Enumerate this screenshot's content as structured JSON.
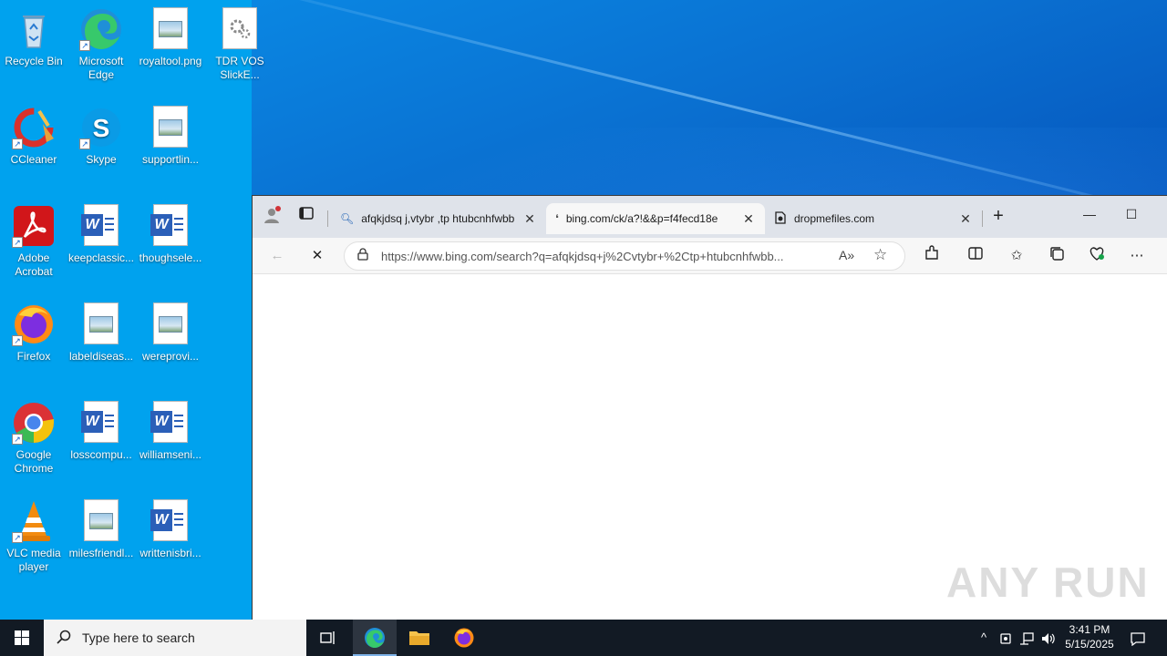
{
  "desktop": {
    "icons": [
      {
        "label": "Recycle Bin",
        "type": "recycle"
      },
      {
        "label": "Microsoft Edge",
        "type": "edge"
      },
      {
        "label": "royaltool.png",
        "type": "image"
      },
      {
        "label": "TDR VOS SlickE...",
        "type": "settings-file"
      },
      {
        "label": "CCleaner",
        "type": "ccleaner"
      },
      {
        "label": "Skype",
        "type": "skype"
      },
      {
        "label": "supportlin...",
        "type": "image"
      },
      {
        "label": "Adobe Acrobat",
        "type": "acrobat"
      },
      {
        "label": "keepclassic...",
        "type": "word"
      },
      {
        "label": "thoughsele...",
        "type": "word"
      },
      {
        "label": "Firefox",
        "type": "firefox"
      },
      {
        "label": "labeldiseas...",
        "type": "image"
      },
      {
        "label": "wereprovi...",
        "type": "image"
      },
      {
        "label": "Google Chrome",
        "type": "chrome"
      },
      {
        "label": "losscompu...",
        "type": "word"
      },
      {
        "label": "williamseni...",
        "type": "word"
      },
      {
        "label": "VLC media player",
        "type": "vlc"
      },
      {
        "label": "milesfriendl...",
        "type": "image"
      },
      {
        "label": "writtenisbri...",
        "type": "word"
      }
    ]
  },
  "browser": {
    "tabs": [
      {
        "title": "afqkjdsq j,vtybr ,tp htubcnhfwbb",
        "icon": "search-icon",
        "active": false
      },
      {
        "title": "bing.com/ck/a?!&&p=f4fecd18e",
        "icon": "loading-icon",
        "active": true
      },
      {
        "title": "dropmefiles.com",
        "icon": "page-icon",
        "active": false
      }
    ],
    "new_tab": "+",
    "address": {
      "url": "https://www.bing.com/search?q=afqkjdsq+j%2Cvtybr+%2Ctp+htubcnhfwbb..."
    },
    "controls": {
      "minimize": "—",
      "maximize": "☐"
    }
  },
  "watermark": "ANY RUN",
  "taskbar": {
    "search_placeholder": "Type here to search",
    "clock_time": "3:41 PM",
    "clock_date": "5/15/2025"
  }
}
